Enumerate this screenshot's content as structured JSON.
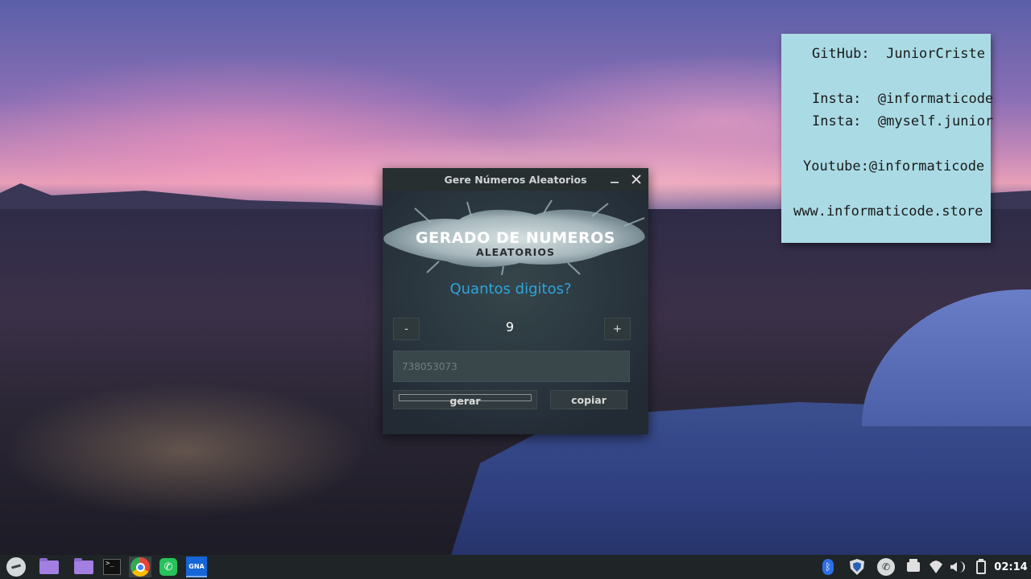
{
  "sticky_note": {
    "lines": [
      "GitHub:  JuniorCriste",
      "Insta:  @informaticode",
      "Insta:  @myself.junior",
      "Youtube:@informaticode",
      "www.informaticode.store"
    ]
  },
  "window": {
    "title": "Gere Números Aleatorios",
    "minimize_icon": "minimize-icon",
    "close_icon": "close-icon",
    "logo": {
      "line1": "GERADO DE NUMEROS",
      "line2": "ALEATORIOS"
    },
    "question": "Quantos digitos?",
    "minus_label": "-",
    "plus_label": "+",
    "digits": "9",
    "result": "738053073",
    "gerar_label": "gerar",
    "copiar_label": "copiar"
  },
  "taskbar": {
    "items": [
      "start-menu-icon",
      "folder-icon",
      "folder-icon",
      "terminal-icon",
      "chrome-icon",
      "whatsapp-icon",
      "gna-app-icon"
    ],
    "gna_label": "GNA",
    "terminal_glyph": ">_",
    "bluetooth_glyph": "ᛒ",
    "whatsapp_glyph": "✆",
    "tray": [
      "bluetooth-icon",
      "shield-icon",
      "whatsapp-tray-icon",
      "printer-icon",
      "wifi-icon",
      "volume-icon",
      "clipboard-icon"
    ],
    "clock": "02:14"
  },
  "colors": {
    "accent": "#2ea4dc",
    "window_bg": "#2b3436",
    "note_bg": "#aadbe5",
    "taskbar_bg": "#1f2426"
  }
}
